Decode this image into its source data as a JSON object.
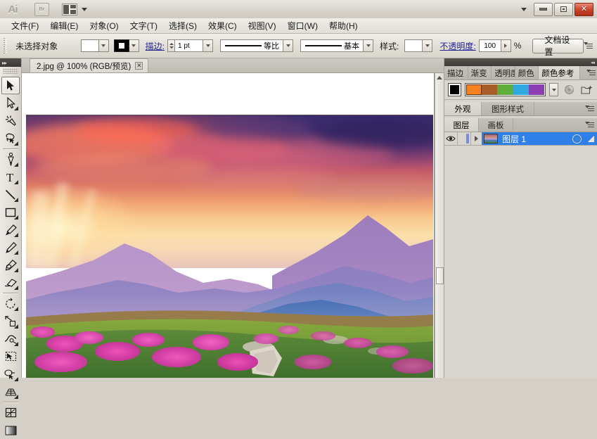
{
  "app": {
    "name": "Adobe Illustrator",
    "logo_text": "Ai",
    "bridge_label": "Br"
  },
  "titlebar": {
    "workspace_icon": "workspace-switcher-icon",
    "dropdown_icon": "chevron-down-icon",
    "minimize_label": "最小化",
    "maximize_label": "最大化",
    "close_label": "关闭"
  },
  "menubar": {
    "items": [
      {
        "label": "文件(F)"
      },
      {
        "label": "编辑(E)"
      },
      {
        "label": "对象(O)"
      },
      {
        "label": "文字(T)"
      },
      {
        "label": "选择(S)"
      },
      {
        "label": "效果(C)"
      },
      {
        "label": "视图(V)"
      },
      {
        "label": "窗口(W)"
      },
      {
        "label": "帮助(H)"
      }
    ]
  },
  "controlbar": {
    "selection_status": "未选择对象",
    "fill_swatch_color": "#ffffff",
    "stroke_swatch_color": "#000000",
    "stroke_label": "描边:",
    "stroke_weight": "1 pt",
    "stroke_profile": "等比",
    "brush_definition": "基本",
    "style_label": "样式:",
    "opacity_label": "不透明度:",
    "opacity_value": "100",
    "opacity_unit": "%",
    "document_setup_button": "文档设置",
    "panel_menu_icon": "panel-menu-icon"
  },
  "toolbar": {
    "tools": [
      {
        "name": "selection-tool",
        "label": "选择工具",
        "active": true
      },
      {
        "name": "direct-selection-tool",
        "label": "直接选择工具",
        "active": false
      },
      {
        "name": "magic-wand-tool",
        "label": "魔棒工具",
        "active": false
      },
      {
        "name": "lasso-tool",
        "label": "套索工具",
        "active": false
      },
      {
        "name": "pen-tool",
        "label": "钢笔工具",
        "active": false
      },
      {
        "name": "type-tool",
        "label": "文字工具",
        "active": false
      },
      {
        "name": "line-segment-tool",
        "label": "直线段工具",
        "active": false
      },
      {
        "name": "rectangle-tool",
        "label": "矩形工具",
        "active": false
      },
      {
        "name": "paintbrush-tool",
        "label": "画笔工具",
        "active": false
      },
      {
        "name": "pencil-tool",
        "label": "铅笔工具",
        "active": false
      },
      {
        "name": "blob-brush-tool",
        "label": "斑点画笔工具",
        "active": false
      },
      {
        "name": "eraser-tool",
        "label": "橡皮擦工具",
        "active": false
      },
      {
        "name": "rotate-tool",
        "label": "旋转工具",
        "active": false
      },
      {
        "name": "scale-tool",
        "label": "比例缩放工具",
        "active": false
      },
      {
        "name": "width-tool",
        "label": "宽度工具",
        "active": false
      },
      {
        "name": "free-transform-tool",
        "label": "自由变换工具",
        "active": false
      },
      {
        "name": "shape-builder-tool",
        "label": "形状生成器工具",
        "active": false
      },
      {
        "name": "perspective-grid-tool",
        "label": "透视网格工具",
        "active": false
      },
      {
        "name": "mesh-tool",
        "label": "网格工具",
        "active": false
      },
      {
        "name": "gradient-tool",
        "label": "渐变工具",
        "active": false
      }
    ]
  },
  "document": {
    "tab_title": "2.jpg @ 100% (RGB/预览)",
    "file_name": "2.jpg",
    "zoom_level": "100%",
    "color_mode": "RGB",
    "view_mode": "预览",
    "close_icon": "close-icon"
  },
  "artwork": {
    "description": "日落山脉与粉色杜鹃花草甸风景照片",
    "sky_colors": [
      "#3b2f6e",
      "#9c4673",
      "#de7a66",
      "#fbdfa8"
    ],
    "mountain_colors": [
      "#b291c4",
      "#9a7fbc",
      "#7b86c4",
      "#4a6fb8",
      "#2f63ad"
    ],
    "meadow_colors": [
      "#d94fb0",
      "#7bb03a",
      "#4f8a3c"
    ]
  },
  "color_guide_panel": {
    "tabs": [
      {
        "label": "描边",
        "selected": false
      },
      {
        "label": "渐变",
        "selected": false
      },
      {
        "label": "透明度",
        "selected": false
      },
      {
        "label": "颜色",
        "selected": false
      },
      {
        "label": "颜色参考",
        "selected": true
      }
    ],
    "base_color": "#000000",
    "swatches": [
      "#f58220",
      "#a85c28",
      "#5fae3c",
      "#30a8e0",
      "#8c3fb5"
    ],
    "active_swatch_index": 0,
    "dropdown_icon": "chevron-down-icon",
    "edit_colors_icon": "edit-colors-icon",
    "save_group_icon": "new-color-group-icon",
    "panel_menu_icon": "panel-menu-icon"
  },
  "appearance_panel": {
    "tabs": [
      {
        "label": "外观",
        "selected": true
      },
      {
        "label": "图形样式",
        "selected": false
      }
    ],
    "panel_menu_icon": "panel-menu-icon"
  },
  "layers_panel": {
    "tabs": [
      {
        "label": "图层",
        "selected": true
      },
      {
        "label": "画板",
        "selected": false
      }
    ],
    "panel_menu_icon": "panel-menu-icon",
    "rows": [
      {
        "name": "图层 1",
        "visible": true,
        "locked": false,
        "selected": true,
        "visibility_icon": "eye-icon",
        "expand_icon": "triangle-right-icon",
        "target_icon": "target-circle-icon"
      }
    ]
  },
  "scrollbar": {
    "up_arrow_icon": "triangle-up-icon",
    "orientation": "vertical"
  }
}
